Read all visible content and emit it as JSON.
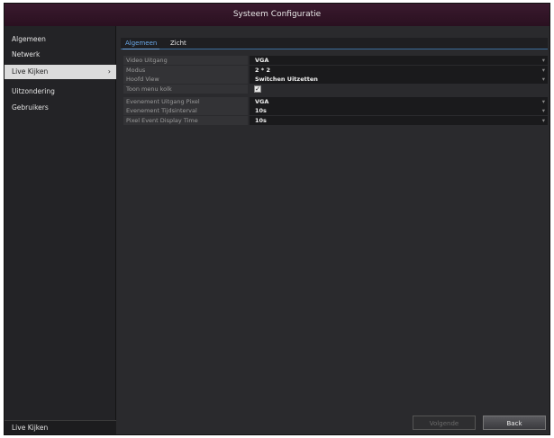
{
  "window": {
    "title": "Systeem Configuratie"
  },
  "sidebar": {
    "items": [
      {
        "label": "Algemeen"
      },
      {
        "label": "Netwerk"
      },
      {
        "label": "Live Kijken",
        "chevron": "›"
      },
      {
        "label": "Uitzondering"
      },
      {
        "label": "Gebruikers"
      }
    ],
    "footer": "Live Kijken"
  },
  "tabs": {
    "active": "Algemeen",
    "inactive": "Zicht"
  },
  "settings": {
    "rows": [
      {
        "label": "Video Uitgang",
        "value": "VGA"
      },
      {
        "label": "Modus",
        "value": "2 * 2"
      },
      {
        "label": "Hoofd View",
        "value": "Switchen Uitzetten"
      },
      {
        "label": "Toon menu kolk",
        "checked": "✓"
      },
      {
        "label": "Evenement Uitgang Pixel",
        "value": "VGA"
      },
      {
        "label": "Evenement Tijdsinterval",
        "value": "10s"
      },
      {
        "label": "Pixel Event Display Time",
        "value": "10s"
      }
    ],
    "caret": "▾"
  },
  "buttons": {
    "previous": "Volgende",
    "back": "Back"
  },
  "colors": {
    "titlebar": "#2a1020",
    "accent": "#6aa8e8",
    "panel": "#2a2a2d"
  }
}
